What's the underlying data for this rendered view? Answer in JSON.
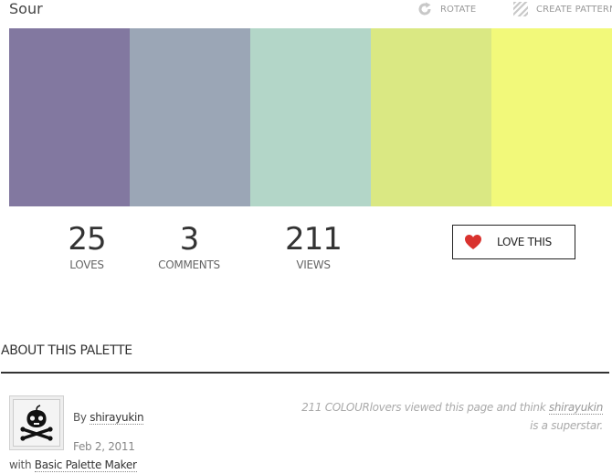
{
  "palette": {
    "title": "Sour",
    "colors": [
      "#8278a0",
      "#9ba6b6",
      "#b3d6c8",
      "#dae883",
      "#f2f97a"
    ]
  },
  "toolbar": {
    "rotate_label": "ROTATE",
    "rotate_icon": "rotate-icon",
    "pattern_label": "CREATE PATTERN",
    "pattern_icon": "pattern-icon"
  },
  "stats": {
    "loves_value": "25",
    "loves_label": "LOVES",
    "comments_value": "3",
    "comments_label": "COMMENTS",
    "views_value": "211",
    "views_label": "VIEWS"
  },
  "love_button": {
    "label": "LOVE THIS",
    "icon": "heart-icon",
    "color": "#d9322e"
  },
  "about": {
    "title": "ABOUT THIS PALETTE",
    "by_prefix": "By",
    "author": "shirayukin",
    "date": "Feb 2, 2011",
    "with_prefix": "with",
    "tool": "Basic Palette Maker",
    "superstar_prefix": "211 COLOURlovers viewed this page and think",
    "superstar_author": "shirayukin",
    "superstar_suffix": "is a superstar."
  }
}
